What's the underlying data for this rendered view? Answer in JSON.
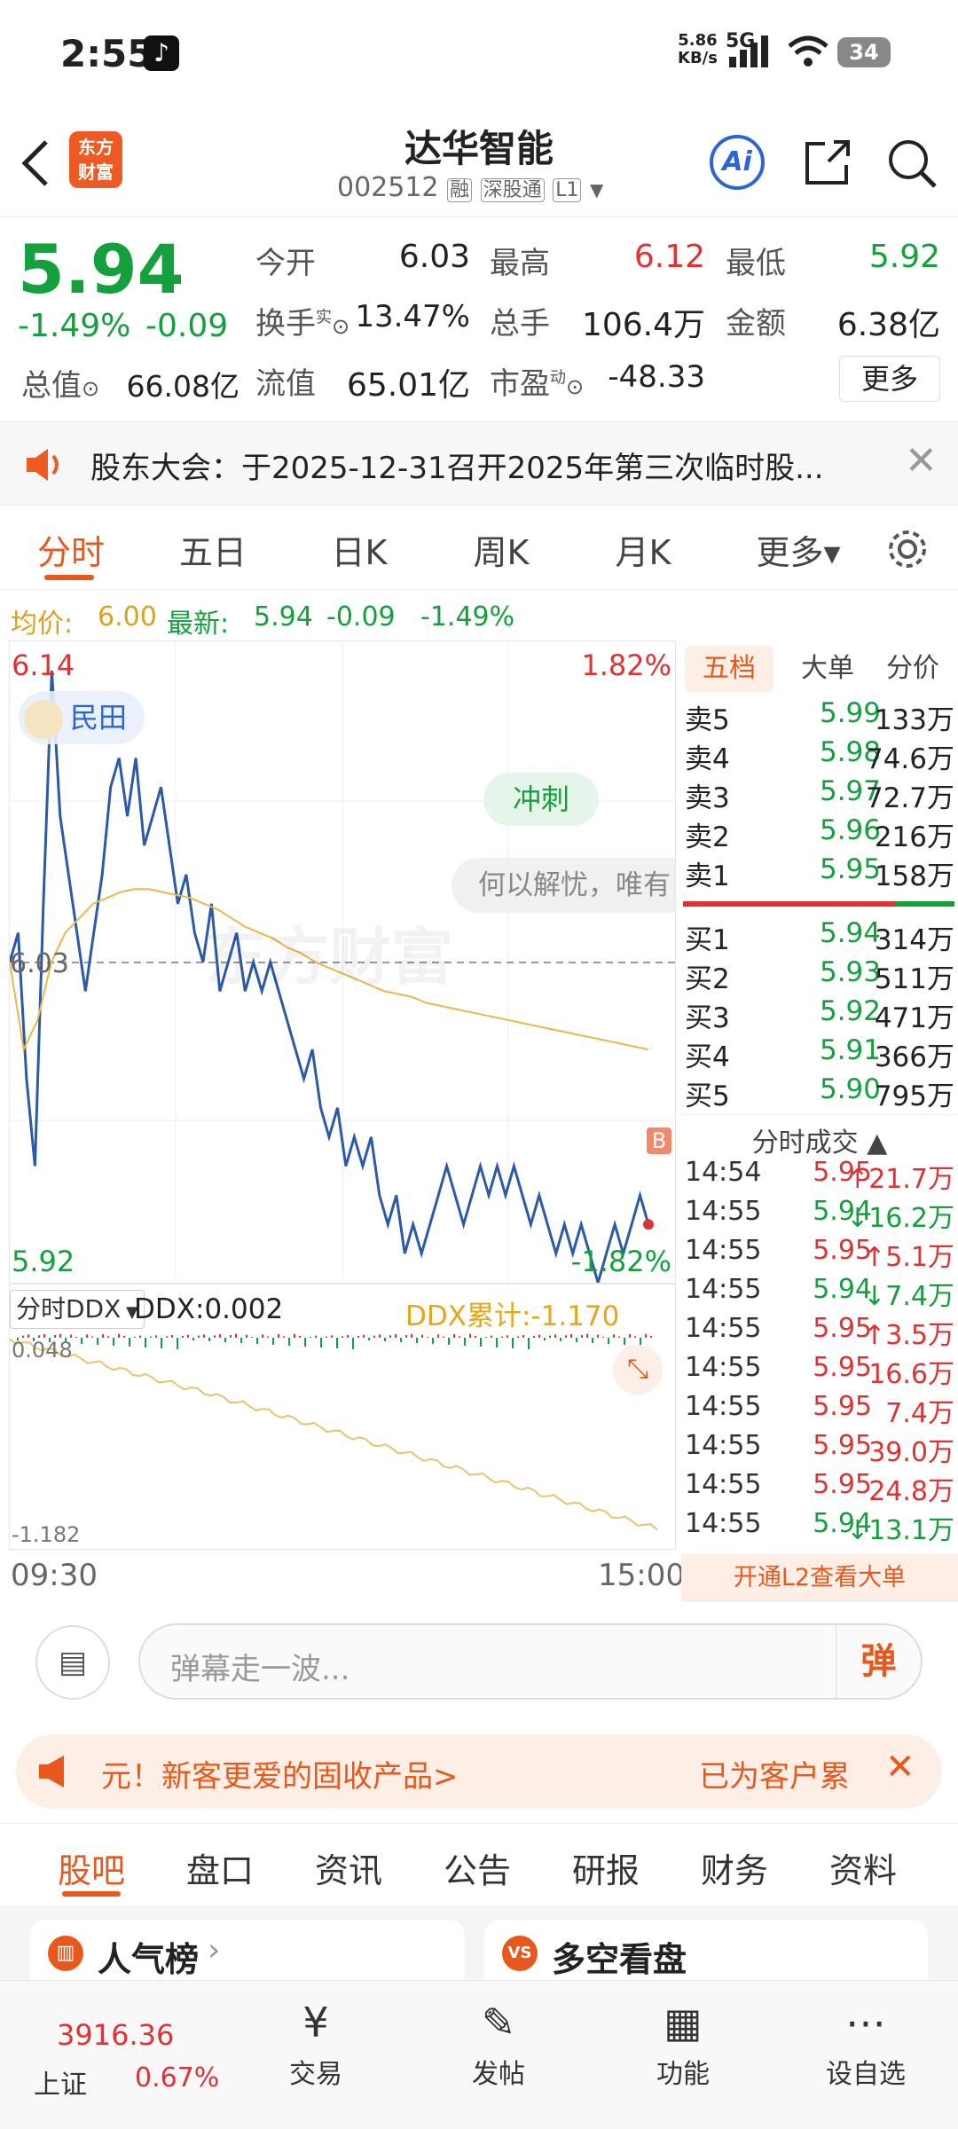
{
  "status": {
    "time": "2:55",
    "net_speed": "5.86",
    "net_unit": "KB/s",
    "net_type": "5G",
    "battery": "34"
  },
  "header": {
    "title": "达华智能",
    "code": "002512",
    "tag_rong": "融",
    "tag_sgt": "深股通",
    "tag_level": "L1",
    "logo_line1": "东方",
    "logo_line2": "财富",
    "ai_label": "Ai"
  },
  "quote": {
    "price": "5.94",
    "change_pct": "-1.49%",
    "change": "-0.09",
    "open_label": "今开",
    "open": "6.03",
    "high_label": "最高",
    "high": "6.12",
    "low_label": "最低",
    "low": "5.92",
    "turnover_label": "换手",
    "turnover_sup": "实",
    "turnover": "13.47%",
    "volume_label": "总手",
    "volume": "106.4万",
    "amount_label": "金额",
    "amount": "6.38亿",
    "mktcap_label": "总值",
    "mktcap": "66.08亿",
    "float_label": "流值",
    "float": "65.01亿",
    "pe_label": "市盈",
    "pe_sup": "动",
    "pe": "-48.33",
    "more_button": "更多"
  },
  "notice": {
    "text": "股东大会：于2025-12-31召开2025年第三次临时股..."
  },
  "tabs": {
    "items": [
      "分时",
      "五日",
      "日K",
      "周K",
      "月K",
      "更多▾"
    ],
    "active": 0
  },
  "infoline": {
    "avg_label": "均价:",
    "avg": "6.00",
    "latest_label": "最新:",
    "latest": "5.94",
    "chg": "-0.09",
    "pct": "-1.49%"
  },
  "chart": {
    "top_price": "6.14",
    "top_pct": "1.82%",
    "mid_price": "6.03",
    "bottom_price": "5.92",
    "bottom_pct": "-1.82%",
    "user_tag": "民田",
    "sprint_label": "冲刺",
    "danmu_text": "何以解忧，唯有",
    "watermark": "东方财富",
    "buy_marker": "B",
    "start_time": "09:30",
    "end_time": "15:00"
  },
  "chart_data": {
    "type": "line",
    "title": "",
    "xlabel": "",
    "ylabel": "",
    "ylim": [
      5.92,
      6.14
    ],
    "x": [
      "09:30",
      "15:00"
    ],
    "series": [
      {
        "name": "最新",
        "values": [
          6.03,
          6.04,
          5.99,
          5.96,
          6.05,
          6.13,
          6.08,
          6.06,
          6.04,
          6.02,
          6.04,
          6.06,
          6.09,
          6.1,
          6.08,
          6.1,
          6.07,
          6.08,
          6.09,
          6.07,
          6.05,
          6.06,
          6.04,
          6.03,
          6.05,
          6.02,
          6.03,
          6.04,
          6.02,
          6.03,
          6.02,
          6.03,
          6.02,
          6.01,
          6.0,
          5.99,
          6.0,
          5.98,
          5.97,
          5.98,
          5.96,
          5.97,
          5.96,
          5.97,
          5.95,
          5.94,
          5.95,
          5.93,
          5.94,
          5.93,
          5.94,
          5.95,
          5.96,
          5.95,
          5.94,
          5.95,
          5.96,
          5.95,
          5.96,
          5.95,
          5.96,
          5.95,
          5.94,
          5.95,
          5.94,
          5.93,
          5.94,
          5.93,
          5.94,
          5.93,
          5.92,
          5.93,
          5.94,
          5.93,
          5.94,
          5.95,
          5.94
        ]
      },
      {
        "name": "均价",
        "values": [
          6.03,
          6.0,
          6.01,
          6.03,
          6.04,
          6.045,
          6.05,
          6.052,
          6.054,
          6.055,
          6.055,
          6.054,
          6.053,
          6.052,
          6.05,
          6.048,
          6.045,
          6.042,
          6.04,
          6.038,
          6.035,
          6.033,
          6.03,
          6.028,
          6.026,
          6.024,
          6.022,
          6.02,
          6.019,
          6.018,
          6.016,
          6.015,
          6.014,
          6.013,
          6.012,
          6.011,
          6.01,
          6.009,
          6.008,
          6.007,
          6.006,
          6.005,
          6.004,
          6.003,
          6.002,
          6.001,
          6.0
        ]
      }
    ]
  },
  "ddx": {
    "selector": "分时DDX",
    "value_label": "DDX:",
    "value": "0.002",
    "cum_label": "DDX累计:",
    "cum": "-1.170",
    "top": "0.048",
    "bottom": "-1.182"
  },
  "book": {
    "tabs": [
      "五档",
      "大单",
      "分价"
    ],
    "asks": [
      {
        "name": "卖5",
        "price": "5.99",
        "vol": "133万"
      },
      {
        "name": "卖4",
        "price": "5.98",
        "vol": "74.6万"
      },
      {
        "name": "卖3",
        "price": "5.97",
        "vol": "72.7万"
      },
      {
        "name": "卖2",
        "price": "5.96",
        "vol": "216万"
      },
      {
        "name": "卖1",
        "price": "5.95",
        "vol": "158万"
      }
    ],
    "bids": [
      {
        "name": "买1",
        "price": "5.94",
        "vol": "314万"
      },
      {
        "name": "买2",
        "price": "5.93",
        "vol": "511万"
      },
      {
        "name": "买3",
        "price": "5.92",
        "vol": "471万"
      },
      {
        "name": "买4",
        "price": "5.91",
        "vol": "366万"
      },
      {
        "name": "买5",
        "price": "5.90",
        "vol": "795万"
      }
    ],
    "trades_title": "分时成交",
    "trades": [
      {
        "t": "14:54",
        "p": "5.95",
        "a": "↑",
        "v": "21.7万",
        "c": "red"
      },
      {
        "t": "14:55",
        "p": "5.94",
        "a": "↓",
        "v": "16.2万",
        "c": "green"
      },
      {
        "t": "14:55",
        "p": "5.95",
        "a": "↑",
        "v": "5.1万",
        "c": "red"
      },
      {
        "t": "14:55",
        "p": "5.94",
        "a": "↓",
        "v": "7.4万",
        "c": "green"
      },
      {
        "t": "14:55",
        "p": "5.95",
        "a": "↑",
        "v": "3.5万",
        "c": "red"
      },
      {
        "t": "14:55",
        "p": "5.95",
        "a": "",
        "v": "16.6万",
        "c": "red"
      },
      {
        "t": "14:55",
        "p": "5.95",
        "a": "",
        "v": "7.4万",
        "c": "red"
      },
      {
        "t": "14:55",
        "p": "5.95",
        "a": "",
        "v": "39.0万",
        "c": "red"
      },
      {
        "t": "14:55",
        "p": "5.95",
        "a": "",
        "v": "24.8万",
        "c": "red"
      },
      {
        "t": "14:55",
        "p": "5.94",
        "a": "↓",
        "v": "13.1万",
        "c": "green"
      }
    ],
    "l2_label": "开通L2查看大单"
  },
  "danmu": {
    "placeholder": "弹幕走一波...",
    "send": "弹"
  },
  "ad": {
    "left": "元！新客更爱的固收产品>",
    "right": "已为客户累"
  },
  "subtabs": {
    "items": [
      "股吧",
      "盘口",
      "资讯",
      "公告",
      "研报",
      "财务",
      "资料"
    ],
    "active": 0
  },
  "cards": {
    "left": "人气榜",
    "right": "多空看盘"
  },
  "bottomnav": {
    "index_value": "3916.36",
    "index_name": "上证",
    "index_pct": "0.67%",
    "items": [
      "交易",
      "发帖",
      "功能",
      "设自选"
    ]
  }
}
